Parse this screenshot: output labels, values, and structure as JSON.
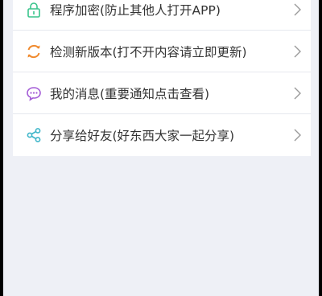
{
  "menu": {
    "items": [
      {
        "label": "程序加密(防止其他人打开APP)",
        "icon": "lock-icon",
        "color": "#39c48c"
      },
      {
        "label": "检测新版本(打不开内容请立即更新)",
        "icon": "refresh-icon",
        "color": "#f08a2e"
      },
      {
        "label": "我的消息(重要通知点击查看)",
        "icon": "message-icon",
        "color": "#a35bd6"
      },
      {
        "label": "分享给好友(好东西大家一起分享)",
        "icon": "share-icon",
        "color": "#3fb6c9"
      }
    ]
  },
  "colors": {
    "background": "#eef0f6",
    "card": "#ffffff",
    "text": "#333333",
    "chevron": "#9a9a9a"
  }
}
